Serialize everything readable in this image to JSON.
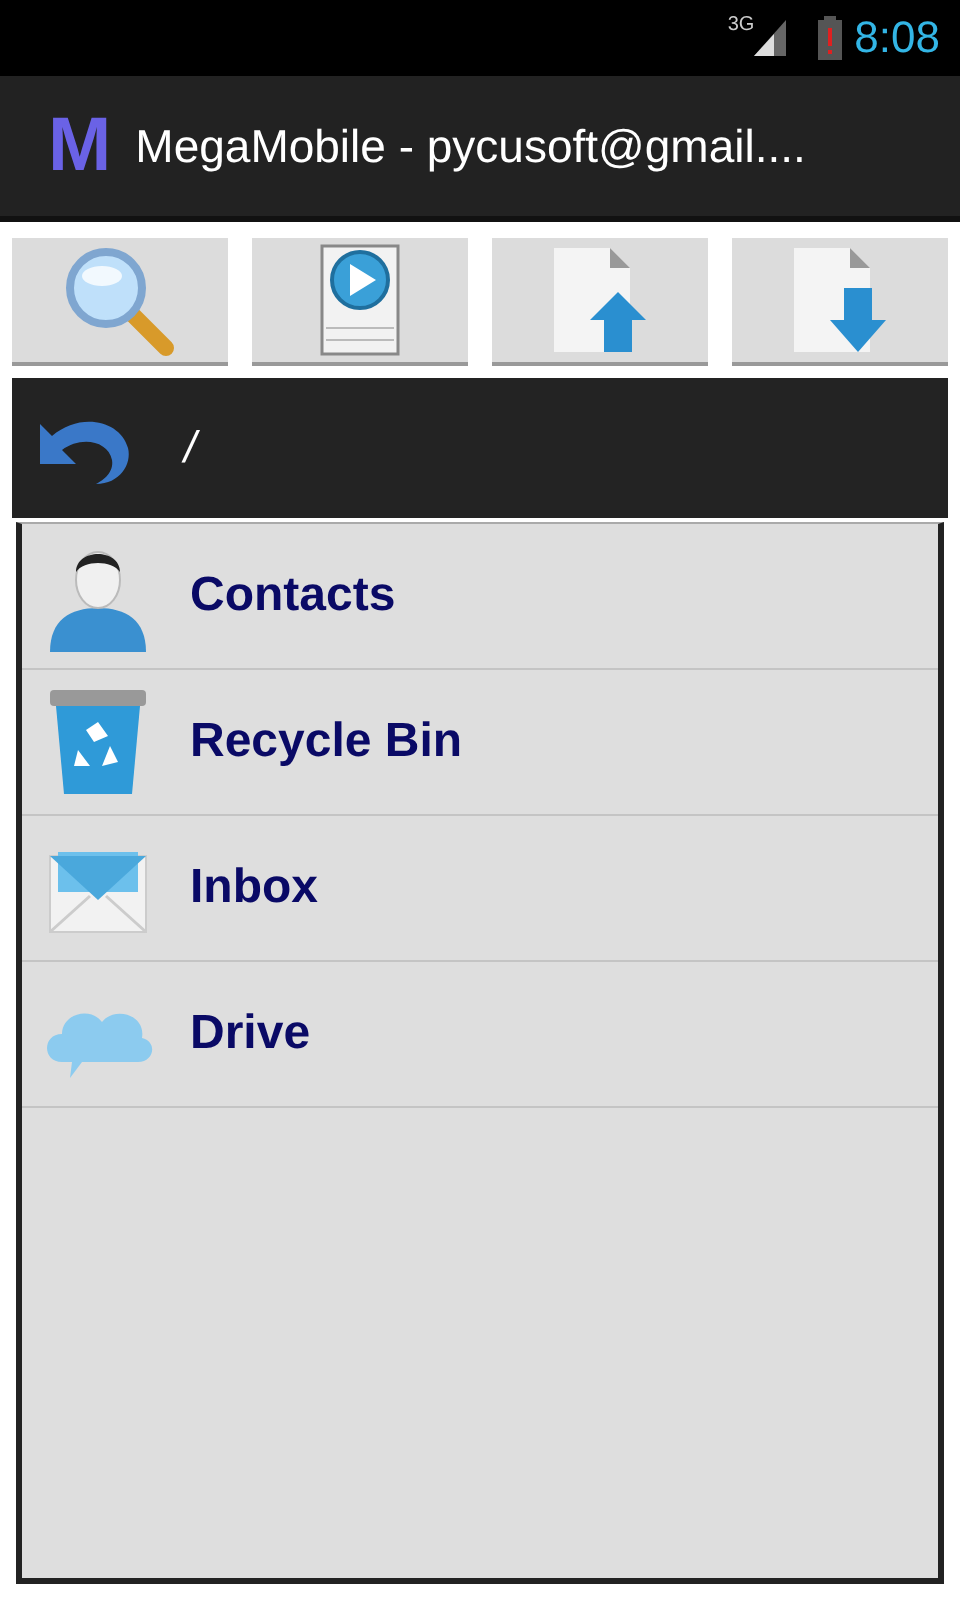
{
  "status_bar": {
    "network": "3G",
    "time": "8:08"
  },
  "action_bar": {
    "logo": "M",
    "title": "MegaMobile - pycusoft@gmail...."
  },
  "toolbar": [
    {
      "kind": "search"
    },
    {
      "kind": "play"
    },
    {
      "kind": "upload"
    },
    {
      "kind": "download"
    }
  ],
  "path_bar": {
    "path": "/"
  },
  "items": [
    {
      "kind": "contacts",
      "label": "Contacts"
    },
    {
      "kind": "trash",
      "label": "Recycle Bin"
    },
    {
      "kind": "inbox",
      "label": "Inbox"
    },
    {
      "kind": "cloud",
      "label": "Drive"
    }
  ]
}
